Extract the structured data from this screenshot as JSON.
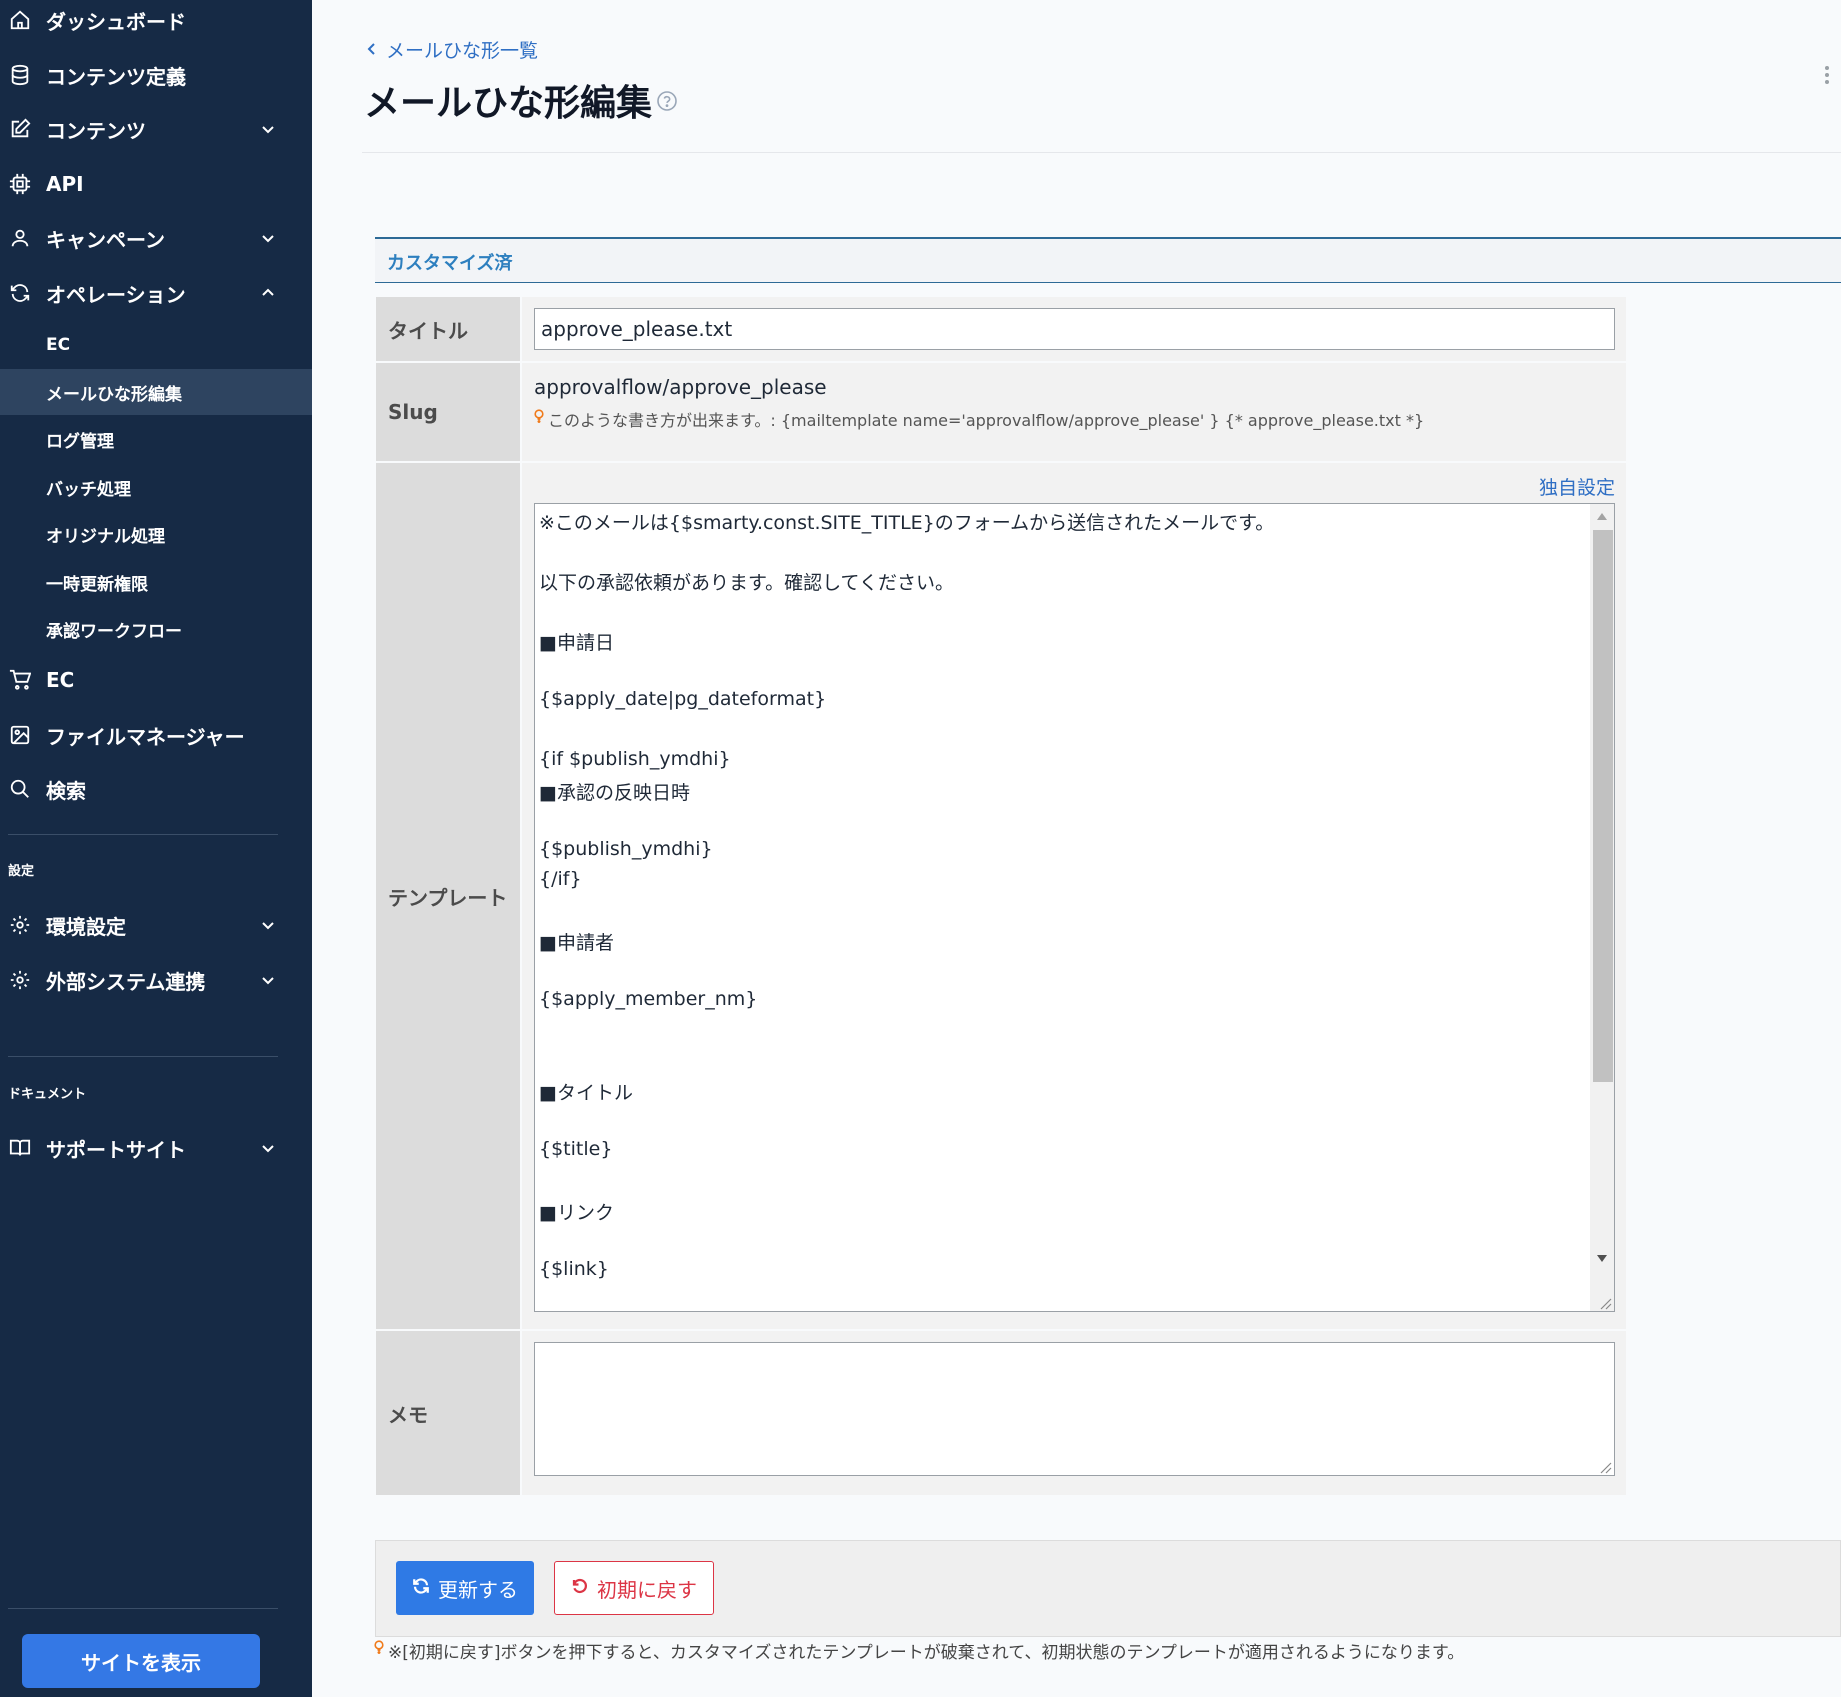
{
  "sidebar": {
    "items": [
      {
        "label": "ダッシュボード",
        "icon": "home-icon"
      },
      {
        "label": "コンテンツ定義",
        "icon": "database-icon"
      },
      {
        "label": "コンテンツ",
        "icon": "edit-icon"
      },
      {
        "label": "API",
        "icon": "chip-icon"
      },
      {
        "label": "キャンペーン",
        "icon": "user-icon"
      },
      {
        "label": "オペレーション",
        "icon": "refresh-icon"
      },
      {
        "label": "EC",
        "icon": "cart-icon"
      },
      {
        "label": "ファイルマネージャー",
        "icon": "image-icon"
      },
      {
        "label": "検索",
        "icon": "search-icon"
      },
      {
        "label": "環境設定",
        "icon": "gear-icon"
      },
      {
        "label": "外部システム連携",
        "icon": "gear-icon"
      },
      {
        "label": "サポートサイト",
        "icon": "book-icon"
      }
    ],
    "operation_sub": [
      "EC",
      "メールひな形編集",
      "ログ管理",
      "バッチ処理",
      "オリジナル処理",
      "一時更新権限",
      "承認ワークフロー"
    ],
    "section_settings": "設定",
    "section_docs": "ドキュメント",
    "site_button": "サイトを表示"
  },
  "header": {
    "breadcrumb": "メールひな形一覧",
    "title": "メールひな形編集"
  },
  "section_title": "カスタマイズ済",
  "form": {
    "title_label": "タイトル",
    "title_value": "approve_please.txt",
    "slug_label": "Slug",
    "slug_value": "approvalflow/approve_please",
    "slug_hint": "このような書き方が出来ます。: {mailtemplate name='approvalflow/approve_please' } {* approve_please.txt *}",
    "template_label": "テンプレート",
    "custom_link": "独自設定",
    "template_lines": [
      "※このメールは{$smarty.const.SITE_TITLE}のフォームから送信されたメールです。",
      "以下の承認依頼があります。確認してください。",
      "■申請日",
      "{$apply_date|pg_dateformat}",
      "{if $publish_ymdhi}",
      "■承認の反映日時",
      "{$publish_ymdhi}",
      "{/if}",
      "■申請者",
      "{$apply_member_nm}",
      "■タイトル",
      "{$title}",
      "■リンク",
      "{$link}"
    ],
    "memo_label": "メモ",
    "memo_value": ""
  },
  "actions": {
    "update": "更新する",
    "reset": "初期に戻す",
    "note": "※[初期に戻す]ボタンを押下すると、カスタマイズされたテンプレートが破棄されて、初期状態のテンプレートが適用されるようになります。"
  },
  "colors": {
    "sidebar_bg": "#162a45",
    "accent": "#2f7ae5",
    "danger": "#dc3545"
  }
}
